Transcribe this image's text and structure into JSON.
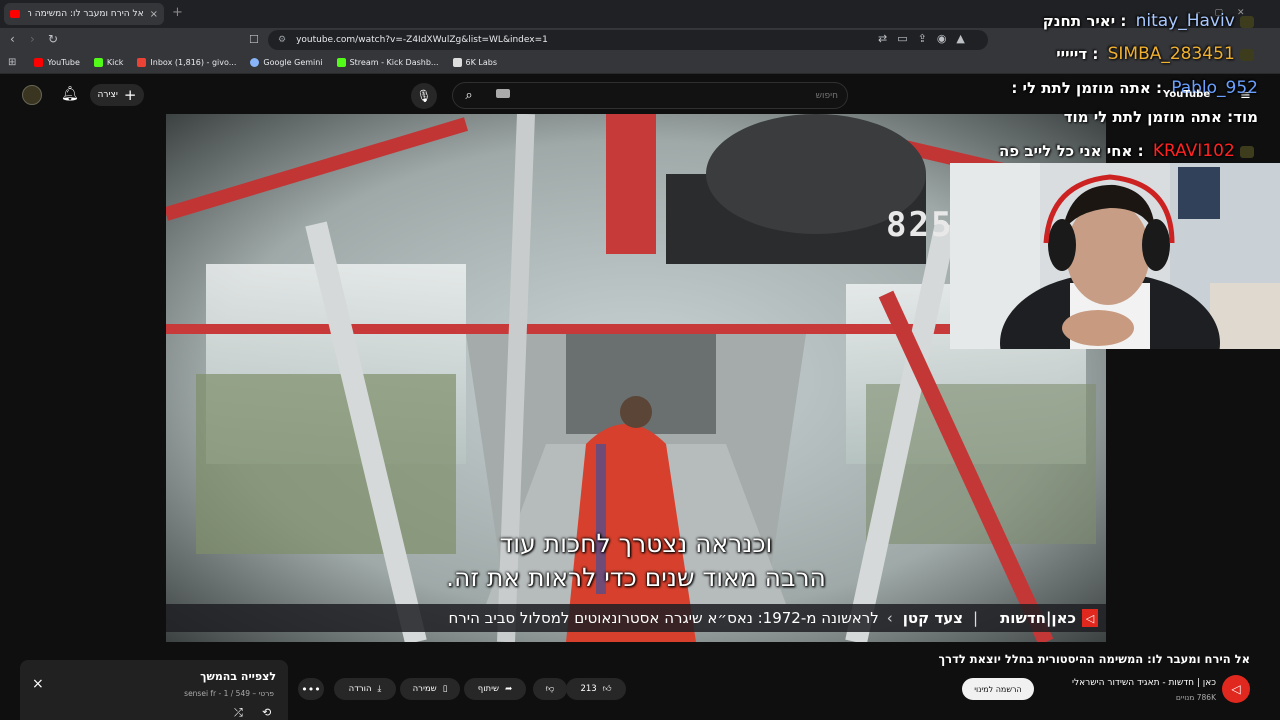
{
  "browser": {
    "tab_title": "אל הירח ומעבר לו: המשימה ההיס",
    "tab_close": "×",
    "new_tab": "+",
    "url": "youtube.com/watch?v=-Z4IdXWulZg&list=WL&index=1",
    "bookmarks": [
      {
        "label": "YouTube",
        "color": "#ff0000"
      },
      {
        "label": "Kick",
        "color": "#53fc18"
      },
      {
        "label": "Inbox (1,816) - givo...",
        "color": "#ea4335"
      },
      {
        "label": "Google Gemini",
        "color": "#8ab4f8"
      },
      {
        "label": "Stream - Kick Dashb...",
        "color": "#53fc18"
      },
      {
        "label": "6K Labs",
        "color": "#dddddd"
      }
    ]
  },
  "youtube": {
    "create_label": "יצירה",
    "search_placeholder": "חיפוש",
    "logo_text": "YouTube"
  },
  "video": {
    "counter": "825",
    "subtitle_line1": "וכנראה נצטרך לחכות עוד",
    "subtitle_line2": "הרבה מאוד שנים כדי לראות את זה.",
    "ticker_brand": "כאן|חדשות",
    "ticker_separator": "|",
    "ticker_segment": "צעד קטן",
    "ticker_chevron": "›",
    "ticker_headline": "לראשונה מ-1972: נאס״א שיגרה אסטרונאוטים למסלול סביב הירח"
  },
  "stream_chat": [
    {
      "user": "nitay_Haviv",
      "message": "יאיר תחנק",
      "color": "#a8c8ff"
    },
    {
      "user": "SIMBA_283451",
      "message": "דייייי",
      "color": "#f0b030"
    },
    {
      "user": "Pablo_952",
      "message": "אתה מוזמן לתת לי :",
      "color": "#6aa0ff"
    },
    {
      "user": "",
      "message": "מוד: אתה מוזמן לתת לי מוד",
      "color": "#ffffff"
    },
    {
      "user": "KRAVI102",
      "message": "אחי אני כל לייב פה",
      "color": "#ff2222"
    }
  ],
  "below_video": {
    "title": "אל הירח ומעבר לו: המשימה ההיסטורית בחלל יוצאת לדרך",
    "channel_name": "כאן | חדשות - תאגיד השידור הישראלי",
    "channel_subs": "786K מנויים",
    "subscribe_label": "הרשמה למינוי",
    "like_count": "213",
    "share_label": "שיתוף",
    "save_label": "שמירה",
    "download_label": "הורדה",
    "more_label": "•••"
  },
  "playlist": {
    "title": "לצפייה בהמשך",
    "meta": "פרטי – sensei fr - 1 / 549",
    "close": "×"
  }
}
